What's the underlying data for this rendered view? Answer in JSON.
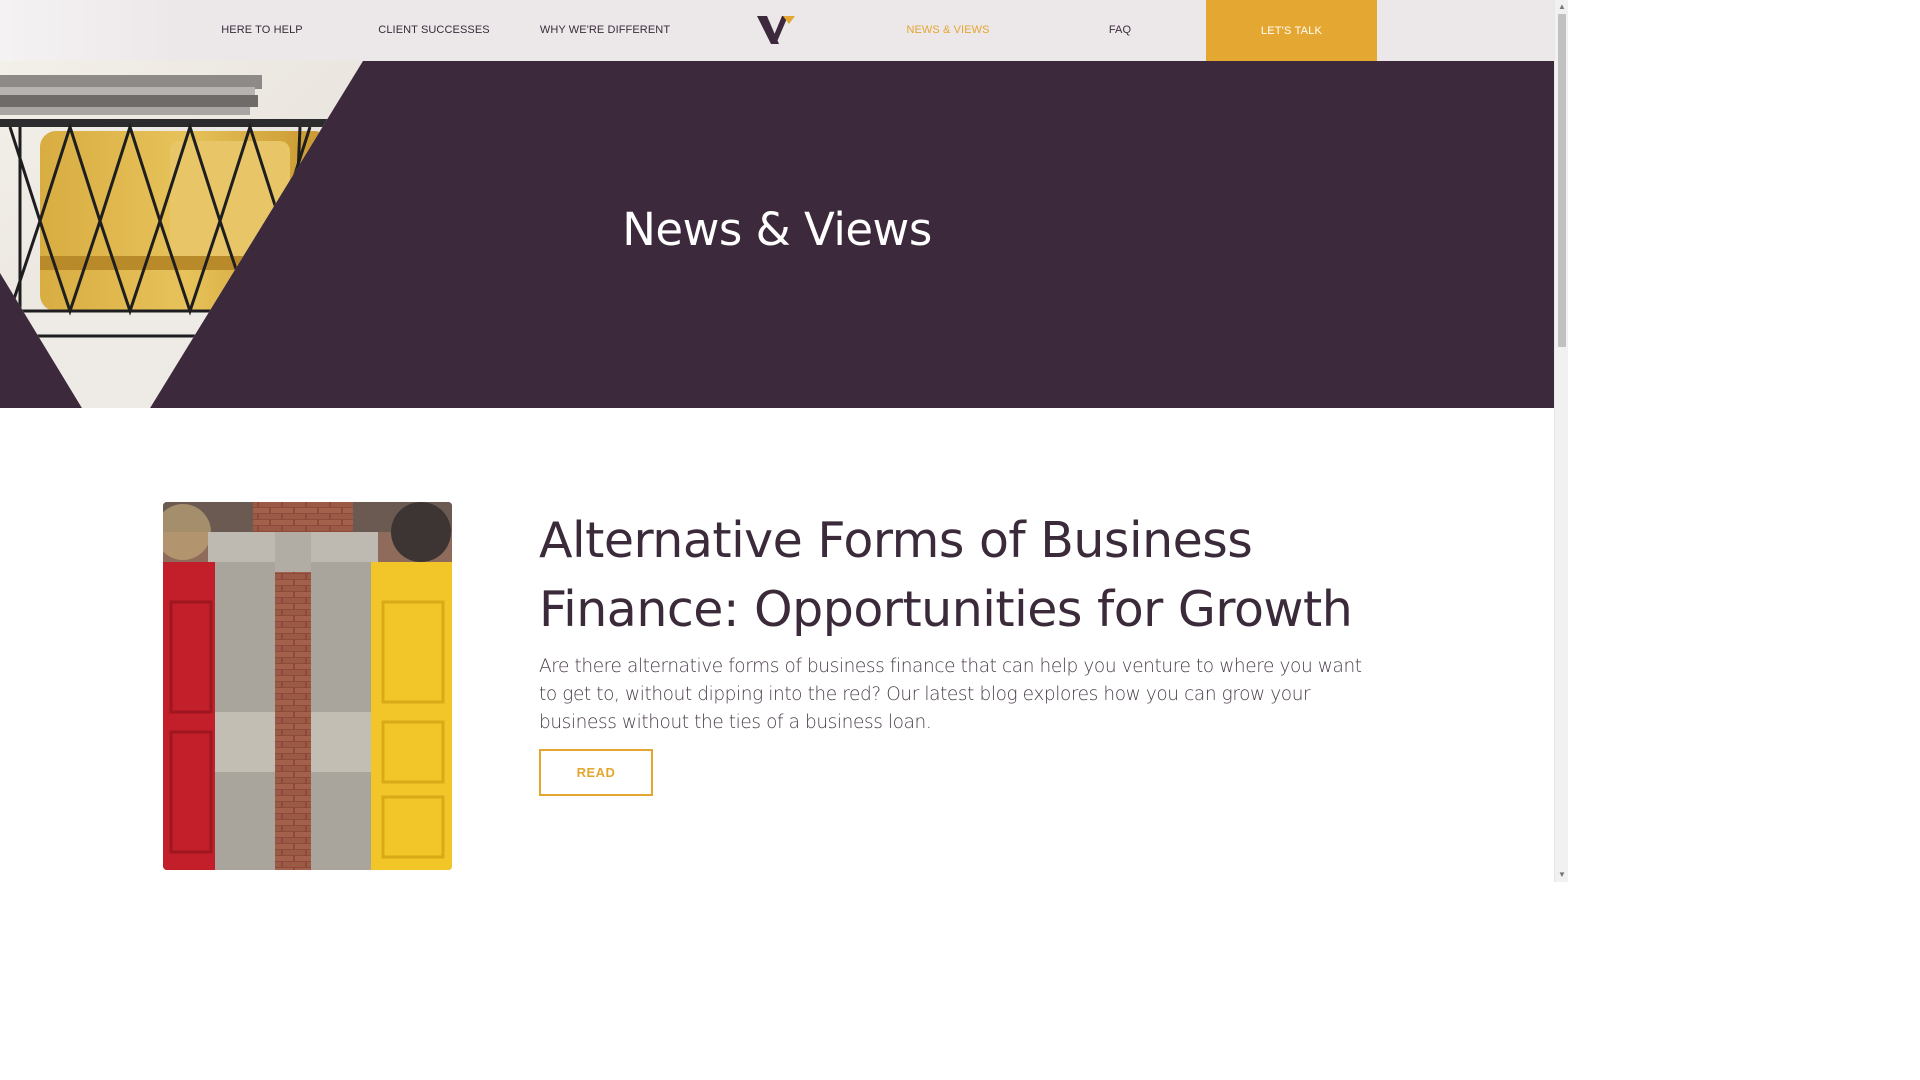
{
  "nav": {
    "links": [
      {
        "label": "HERE TO HELP"
      },
      {
        "label": "CLIENT SUCCESSES"
      },
      {
        "label": "WHY WE'RE DIFFERENT"
      },
      {
        "label": "NEWS & VIEWS",
        "active": true
      },
      {
        "label": "FAQ"
      }
    ],
    "cta_label": "LET'S TALK"
  },
  "hero": {
    "title": "News & Views"
  },
  "article": {
    "title": "Alternative Forms of Business Finance: Opportunities for Growth",
    "excerpt": "Are there alternative forms of business finance that can help you venture to where you want to get to, without dipping into the red? Our latest blog explores how you can grow your business without the ties of a business loan.",
    "read_label": "READ"
  },
  "colors": {
    "brand_dark": "#3c2a3c",
    "accent": "#e4a731",
    "nav_bg": "#ece8ea"
  },
  "icons": {
    "logo": "v-logo-icon",
    "scroll_up": "chevron-up-icon",
    "scroll_down": "chevron-down-icon"
  }
}
